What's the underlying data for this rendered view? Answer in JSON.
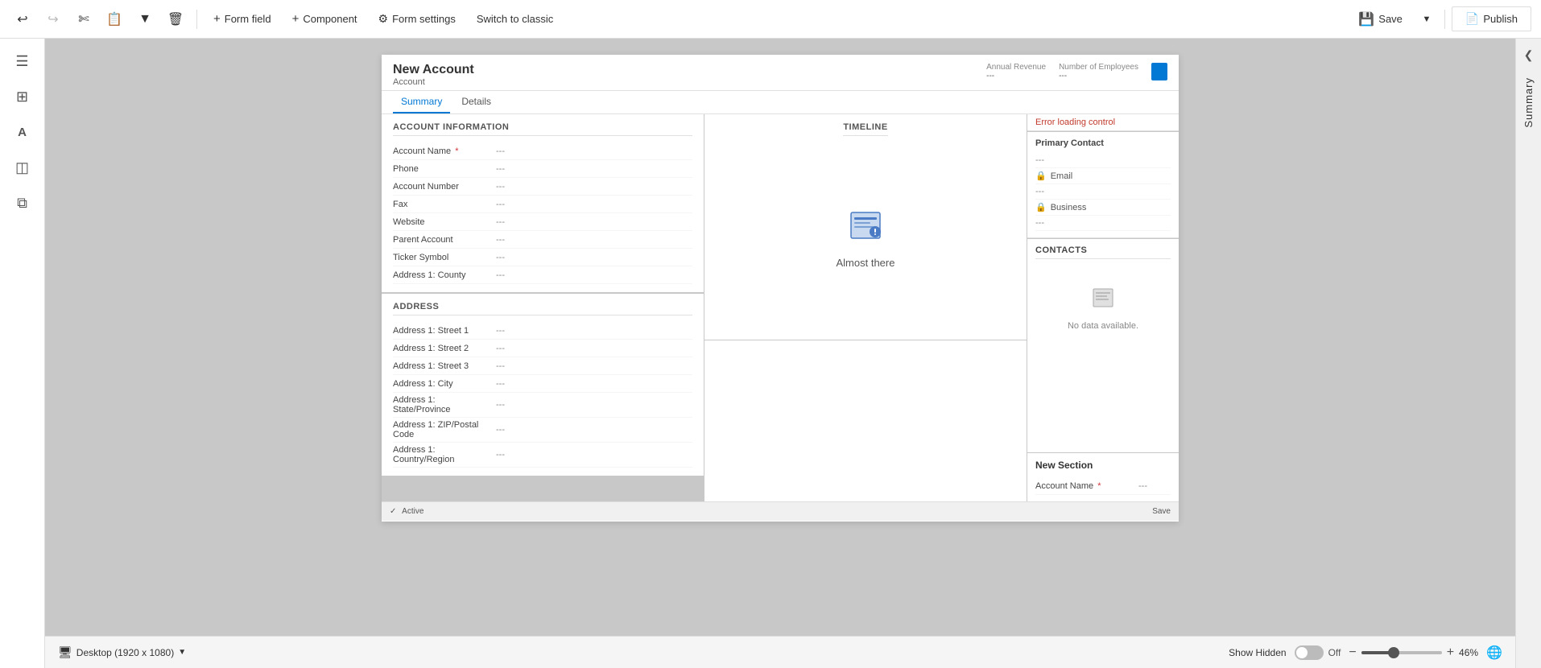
{
  "toolbar": {
    "undo_title": "Undo",
    "redo_title": "Redo",
    "cut_title": "Cut",
    "copy_title": "Copy",
    "dropdown_title": "",
    "delete_title": "Delete",
    "form_field_label": "Form field",
    "component_label": "Component",
    "form_settings_label": "Form settings",
    "switch_classic_label": "Switch to classic",
    "save_label": "Save",
    "publish_label": "Publish"
  },
  "sidebar": {
    "items": [
      {
        "name": "menu",
        "icon": "☰"
      },
      {
        "name": "dashboard",
        "icon": "⊞"
      },
      {
        "name": "text",
        "icon": "A"
      },
      {
        "name": "layers",
        "icon": "◫"
      },
      {
        "name": "components",
        "icon": "⧉"
      }
    ]
  },
  "right_panel": {
    "close_icon": "❯",
    "label": "Summary"
  },
  "form": {
    "title": "New Account",
    "subtitle": "Account",
    "header_fields": [
      {
        "label": "Annual Revenue",
        "value": "---"
      },
      {
        "label": "Number of Employees",
        "value": "---"
      }
    ],
    "tabs": [
      {
        "label": "Summary",
        "active": true
      },
      {
        "label": "Details",
        "active": false
      }
    ],
    "account_info": {
      "section_title": "ACCOUNT INFORMATION",
      "fields": [
        {
          "label": "Account Name",
          "required": true,
          "value": "---"
        },
        {
          "label": "Phone",
          "required": false,
          "value": "---"
        },
        {
          "label": "Account Number",
          "required": false,
          "value": "---"
        },
        {
          "label": "Fax",
          "required": false,
          "value": "---"
        },
        {
          "label": "Website",
          "required": false,
          "value": "---"
        },
        {
          "label": "Parent Account",
          "required": false,
          "value": "---"
        },
        {
          "label": "Ticker Symbol",
          "required": false,
          "value": "---"
        },
        {
          "label": "Address 1: County",
          "required": false,
          "value": "---"
        }
      ]
    },
    "address": {
      "section_title": "ADDRESS",
      "fields": [
        {
          "label": "Address 1: Street 1",
          "value": "---"
        },
        {
          "label": "Address 1: Street 2",
          "value": "---"
        },
        {
          "label": "Address 1: Street 3",
          "value": "---"
        },
        {
          "label": "Address 1: City",
          "value": "---"
        },
        {
          "label": "Address 1: State/Province",
          "value": "---"
        },
        {
          "label": "Address 1: ZIP/Postal Code",
          "value": "---"
        },
        {
          "label": "Address 1: Country/Region",
          "value": "---"
        }
      ]
    },
    "timeline": {
      "section_title": "Timeline",
      "icon": "🗂",
      "message": "Almost there"
    },
    "right_top": {
      "error_text": "Error loading control"
    },
    "primary_contact": {
      "title": "Primary Contact",
      "value": "---",
      "email_label": "Email",
      "email_value": "---",
      "business_label": "Business",
      "business_value": "---"
    },
    "contacts": {
      "section_title": "CONTACTS",
      "no_data_text": "No data available."
    },
    "new_section": {
      "title": "New Section",
      "field_label": "Account Name",
      "field_required": true,
      "field_value": "---"
    }
  },
  "bottom_bar": {
    "desktop_label": "Desktop (1920 x 1080)",
    "show_hidden_label": "Show Hidden",
    "toggle_state": "Off",
    "zoom_minus": "−",
    "zoom_plus": "+",
    "zoom_value": "46%",
    "status_active": "Active",
    "status_save": "Save"
  }
}
